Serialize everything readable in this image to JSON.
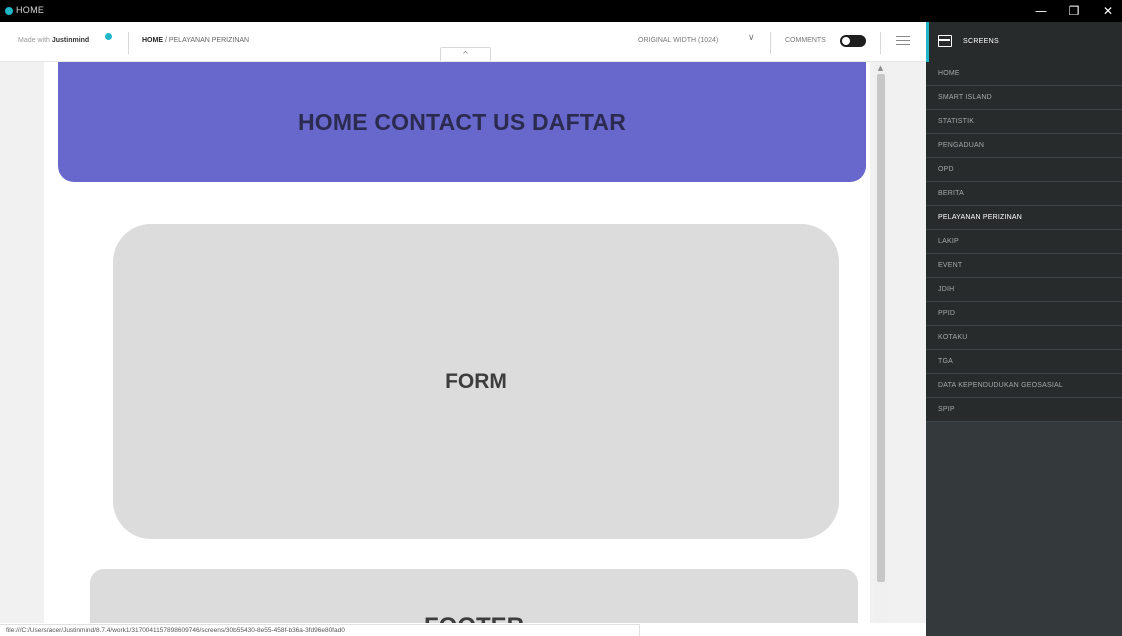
{
  "window": {
    "title": "HOME",
    "minimize": "—",
    "maximize": "❐",
    "close": "✕"
  },
  "toolbar": {
    "made_with_prefix": "Made with ",
    "made_with_brand": "Justinmind",
    "breadcrumb_current": "HOME",
    "breadcrumb_rest": " / PELAYANAN PERIZINAN",
    "collapse_glyph": "^",
    "original_width": "ORIGINAL WIDTH (1024)",
    "chevron": "∨",
    "comments_label": "COMMENTS"
  },
  "canvas": {
    "hero_text": "HOME CONTACT US DAFTAR",
    "form_text": "FORM",
    "footer_text": "FOOTER"
  },
  "colors": {
    "accent": "#21b7c8",
    "hero": "#6767cc",
    "sidebar": "#343a3b"
  },
  "status_url": "file:///C:/Users/acer/Justinmind/8.7.4/work1/3170041157898609746/screens/30b55430-8e55-458f-b36a-3fd96e80fad0",
  "sidebar": {
    "title": "SCREENS",
    "icon": "screens-icon",
    "items": [
      {
        "label": "HOME"
      },
      {
        "label": "SMART ISLAND"
      },
      {
        "label": "STATISTIK"
      },
      {
        "label": "PENGADUAN"
      },
      {
        "label": "OPD"
      },
      {
        "label": "BERITA"
      },
      {
        "label": "PELAYANAN PERIZINAN"
      },
      {
        "label": "LAKIP"
      },
      {
        "label": "EVENT"
      },
      {
        "label": "JDIH"
      },
      {
        "label": "PPID"
      },
      {
        "label": "KOTAKU"
      },
      {
        "label": "TGA"
      },
      {
        "label": "DATA KEPENDUDUKAN GEOSASIAL"
      },
      {
        "label": "SPIP"
      }
    ],
    "active_index": 6
  }
}
